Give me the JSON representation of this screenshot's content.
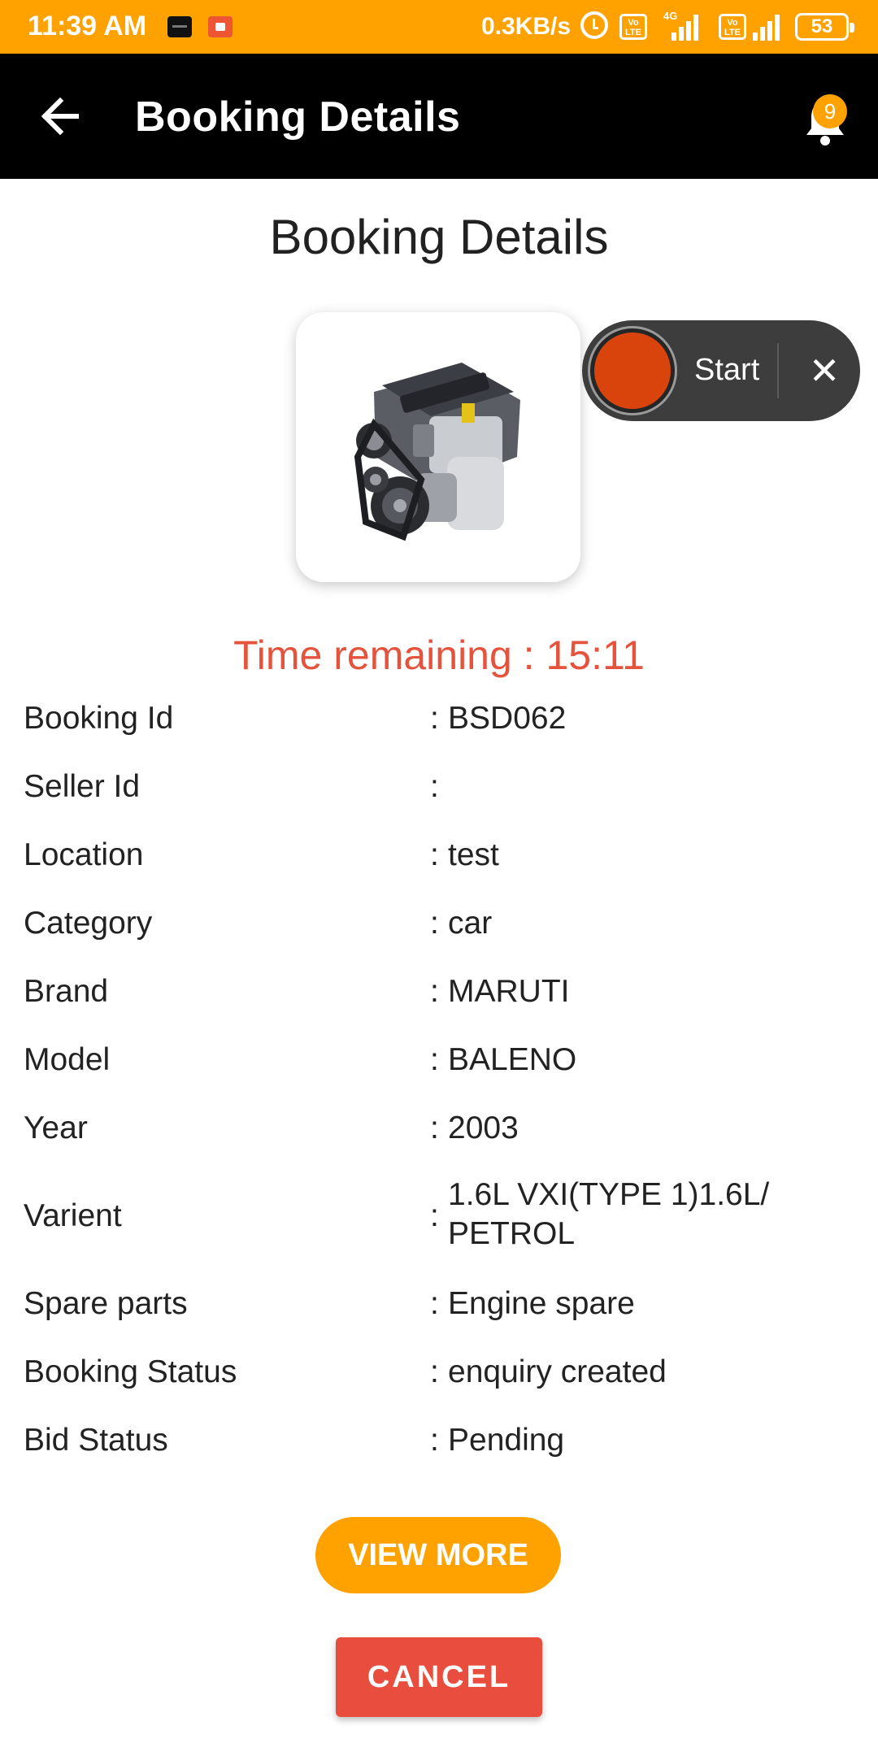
{
  "status_bar": {
    "time": "11:39 AM",
    "network_speed": "0.3KB/s",
    "network_type": "4G",
    "volte_label": "Vo LTE",
    "battery": "53",
    "background_color": "#FFA200"
  },
  "app_bar": {
    "title": "Booking Details",
    "back_icon": "arrow-left-icon",
    "notification_icon": "bell-icon",
    "notification_count": "9"
  },
  "page": {
    "heading": "Booking Details",
    "product_image": "engine-image",
    "timer_text": "Time remaining : 15:11",
    "timer_color": "#E5533D"
  },
  "start_widget": {
    "label": "Start",
    "close_icon": "close-icon",
    "knob_color": "#D9440D"
  },
  "details": {
    "rows": [
      {
        "label": "Booking Id",
        "colon": ":",
        "value": "BSD062"
      },
      {
        "label": "Seller Id",
        "colon": ":",
        "value": ""
      },
      {
        "label": "Location",
        "colon": ":",
        "value": "test"
      },
      {
        "label": "Category",
        "colon": ":",
        "value": "car"
      },
      {
        "label": "Brand",
        "colon": ":",
        "value": "MARUTI"
      },
      {
        "label": "Model",
        "colon": ":",
        "value": "BALENO"
      },
      {
        "label": "Year",
        "colon": ":",
        "value": "2003"
      },
      {
        "label": "Varient",
        "colon": ":",
        "value": "1.6L VXI(TYPE 1)1.6L/ PETROL"
      },
      {
        "label": "Spare parts",
        "colon": ":",
        "value": "Engine spare"
      },
      {
        "label": "Booking Status",
        "colon": ":",
        "value": "enquiry created"
      },
      {
        "label": "Bid Status",
        "colon": ":",
        "value": "Pending"
      }
    ]
  },
  "actions": {
    "view_more_label": "VIEW MORE",
    "cancel_label": "CANCEL",
    "accent_color": "#FFA200",
    "cancel_color": "#E84D3D"
  }
}
